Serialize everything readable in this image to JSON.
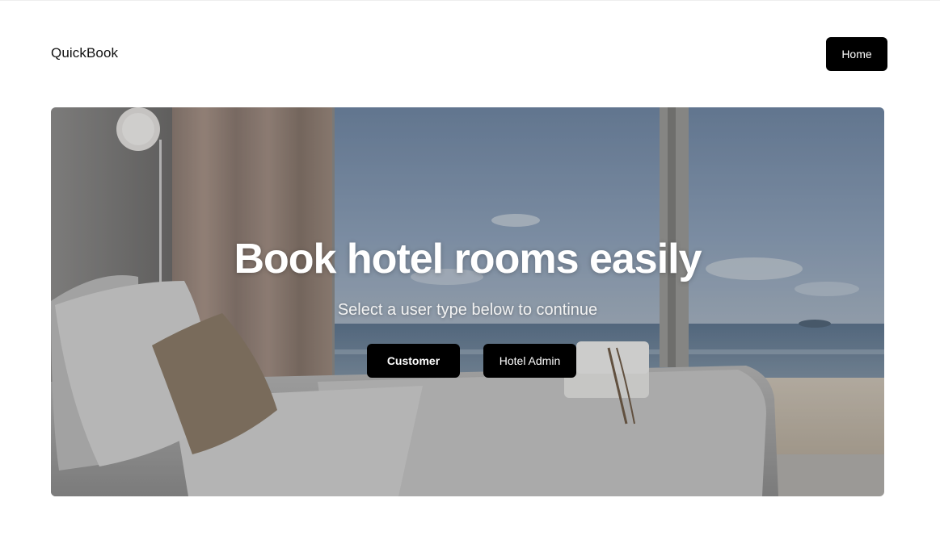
{
  "header": {
    "brand": "QuickBook",
    "home_label": "Home"
  },
  "hero": {
    "title": "Book hotel rooms easily",
    "subtitle": "Select a user type below to continue",
    "image_description_icon": "hotel-room-photo",
    "buttons": [
      {
        "label": "Customer"
      },
      {
        "label": "Hotel Admin"
      }
    ]
  },
  "colors": {
    "button_bg": "#000000",
    "button_text": "#ffffff",
    "page_bg": "#ffffff"
  }
}
